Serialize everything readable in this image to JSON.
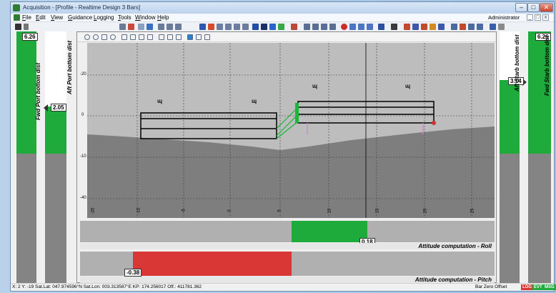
{
  "window": {
    "title": "Acquisition - [Profile - Realtime Design 3 Bars]",
    "controls": {
      "minimize": "–",
      "maximize": "□",
      "close": "✕"
    }
  },
  "menubar": {
    "items": [
      "File",
      "Edit",
      "View",
      "Guidance",
      "Logging",
      "Tools",
      "Window",
      "Help"
    ],
    "user": "Administrator",
    "mdi": {
      "minimize": "_",
      "restore": "□",
      "close": "x"
    }
  },
  "profile": {
    "depth_ticks": [
      "-20",
      "0",
      "-10",
      "-20",
      "-40"
    ],
    "chainage_ticks": [
      "-20",
      "-10",
      "-5",
      "0",
      "5",
      "10",
      "15",
      "20",
      "25"
    ]
  },
  "left_panel": {
    "fwd_port": {
      "value": "6.26",
      "label": "Fwd Port bottom dist"
    },
    "aft_port": {
      "value": "2.05",
      "label": "Aft Port bottom dist"
    }
  },
  "right_panel": {
    "aft_starb": {
      "value": "3.14",
      "label": "Aft Starb bottom dist"
    },
    "fwd_starb": {
      "value": "6.26",
      "label": "Fwd Starb bottom dist"
    }
  },
  "attitude": {
    "roll": {
      "value": "0.18",
      "label": "Attitude computation - Roll",
      "color": "#1faa3c"
    },
    "pitch": {
      "value": "-0.38",
      "label": "Attitude computation - Pitch",
      "color": "#d93636"
    }
  },
  "status": {
    "text": "X: 2  Y: -19  Sat.Lat: 047.974596°N  Sat.Lon: 003.313587°E  KP: 174.256017  Off.: 411781.362",
    "mode": "Bar  Zero Offset",
    "badges": [
      "LOG",
      "EVT",
      "MSG"
    ]
  },
  "colors": {
    "green": "#1faa3c",
    "red": "#d93636",
    "gray": "#848484"
  }
}
